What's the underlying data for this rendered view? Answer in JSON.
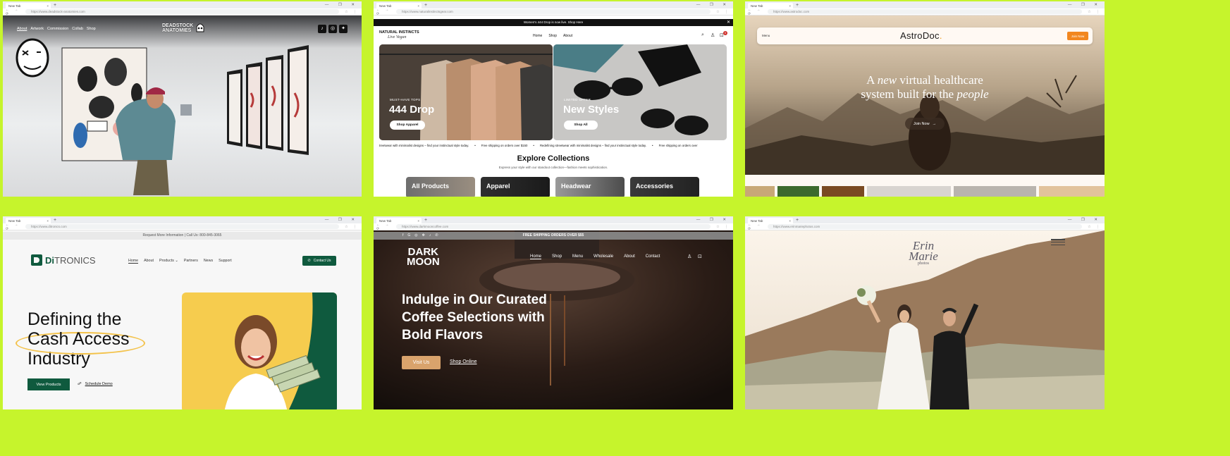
{
  "browser": {
    "tab_title": "New Tab",
    "tab_close": "×",
    "new_tab": "+",
    "window_controls": "— ❐ ✕",
    "nav_buttons": "← → ⟳",
    "toolbar_icons": "☆ ⋮"
  },
  "w1": {
    "url": "https://www.deadstock-anatomies.com",
    "nav": [
      "About",
      "Artwork",
      "Commission",
      "Collab",
      "Shop"
    ],
    "logo_line1": "DEADSTOCK",
    "logo_line2": "ANATOMIES",
    "social_icons": [
      "tiktok-icon",
      "instagram-icon",
      "twitter-icon"
    ]
  },
  "w2": {
    "url": "https://www.naturalinstinctsgear.com",
    "announcement": "Women's 444 Drop is now live. Shop Here",
    "logo_line1": "NATURAL INSTINCTS",
    "logo_line2": "Live Vegan",
    "nav": [
      "Home",
      "Shop",
      "About"
    ],
    "cart_count": "0",
    "card1": {
      "tag": "MUST-HAVE TOPS",
      "title": "444 Drop",
      "button": "Shop Apparel"
    },
    "card2": {
      "tag": "LIMITED OFFER",
      "title": "New Styles",
      "button": "Shop All"
    },
    "marquee": [
      "treetwear with minimalist designs – find your instinctual style today.",
      "Free shipping on orders over $150",
      "Redefining streetwear with minimalist designs – find your instinctual style today.",
      "Free shipping on orders over"
    ],
    "collections_title": "Explore Collections",
    "collections_sub": "Express your style with our standout collection—fashion meets sophistication.",
    "collections": [
      "All Products",
      "Apparel",
      "Headwear",
      "Accessories"
    ]
  },
  "w3": {
    "url": "https://www.astrodoc.com",
    "menu": "Menu",
    "logo": "AstroDoc",
    "join_btn": "Join Now",
    "headline_a": "A ",
    "headline_new": "new",
    "headline_b": " virtual healthcare",
    "headline_c": "system built for the ",
    "headline_people": "people",
    "cta": "Join Now"
  },
  "w4": {
    "url": "https://www.ditronics.com",
    "topbar": "Request More Information | Call Us: 800-845-3065",
    "logo_a": "Di",
    "logo_b": "TRONICS",
    "nav": [
      "Home",
      "About",
      "Products",
      "Partners",
      "News",
      "Support"
    ],
    "contact_btn": "Contact Us",
    "hero_line1": "Defining the",
    "hero_line2": "Cash Access",
    "hero_line3": "Industry",
    "view_btn": "View Products",
    "demo_link": "Schedule Demo"
  },
  "w5": {
    "url": "https://www.darkmooncoffee.com",
    "shipping": "FREE SHIPPING ORDERS OVER $55",
    "logo_line1": "DARK",
    "logo_line2": "MOON",
    "nav": [
      "Home",
      "Shop",
      "Menu",
      "Wholesale",
      "About",
      "Contact"
    ],
    "hero_line1": "Indulge in Our Curated",
    "hero_line2": "Coffee Selections with",
    "hero_line3": "Bold Flavors",
    "visit_btn": "Visit Us",
    "shop_link": "Shop Online"
  },
  "w6": {
    "url": "https://www.erinmariephotos.com",
    "logo_line1": "Erin",
    "logo_line2": "Marie",
    "logo_line3": "photos"
  }
}
